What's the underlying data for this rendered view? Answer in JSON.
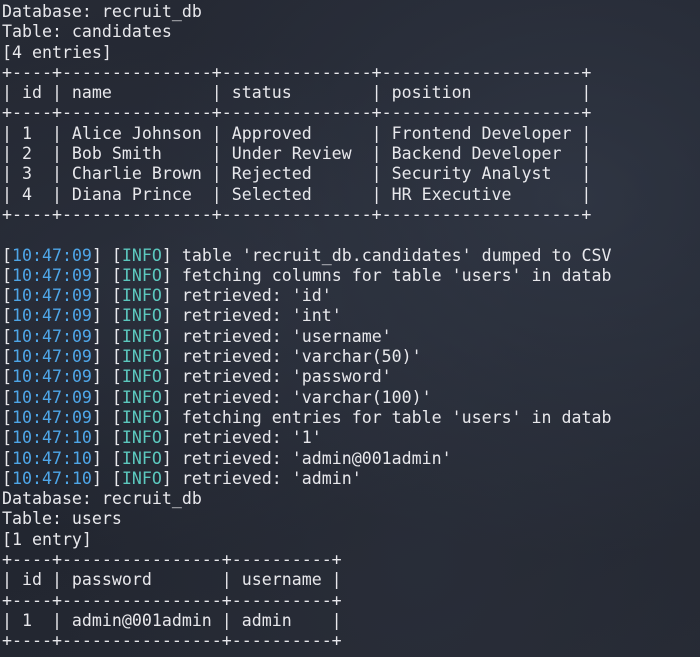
{
  "colors": {
    "background": "#232733",
    "text": "#e8e8ec",
    "timestamp": "#4ea6e8",
    "info_level": "#5cc8be"
  },
  "lines": [
    {
      "text": "Database: recruit_db"
    },
    {
      "text": "Table: candidates"
    },
    {
      "text": "[4 entries]"
    },
    {
      "text": "+----+---------------+---------------+--------------------+"
    },
    {
      "text": "| id | name          | status        | position           |"
    },
    {
      "text": "+----+---------------+---------------+--------------------+"
    },
    {
      "text": "| 1  | Alice Johnson | Approved      | Frontend Developer |"
    },
    {
      "text": "| 2  | Bob Smith     | Under Review  | Backend Developer  |"
    },
    {
      "text": "| 3  | Charlie Brown | Rejected      | Security Analyst   |"
    },
    {
      "text": "| 4  | Diana Prince  | Selected      | HR Executive       |"
    },
    {
      "text": "+----+---------------+---------------+--------------------+"
    },
    {
      "text": ""
    },
    {
      "time": "10:47:09",
      "level": "INFO",
      "msg": "table 'recruit_db.candidates' dumped to CSV"
    },
    {
      "time": "10:47:09",
      "level": "INFO",
      "msg": "fetching columns for table 'users' in datab"
    },
    {
      "time": "10:47:09",
      "level": "INFO",
      "msg": "retrieved: 'id'"
    },
    {
      "time": "10:47:09",
      "level": "INFO",
      "msg": "retrieved: 'int'"
    },
    {
      "time": "10:47:09",
      "level": "INFO",
      "msg": "retrieved: 'username'"
    },
    {
      "time": "10:47:09",
      "level": "INFO",
      "msg": "retrieved: 'varchar(50)'"
    },
    {
      "time": "10:47:09",
      "level": "INFO",
      "msg": "retrieved: 'password'"
    },
    {
      "time": "10:47:09",
      "level": "INFO",
      "msg": "retrieved: 'varchar(100)'"
    },
    {
      "time": "10:47:09",
      "level": "INFO",
      "msg": "fetching entries for table 'users' in datab"
    },
    {
      "time": "10:47:10",
      "level": "INFO",
      "msg": "retrieved: '1'"
    },
    {
      "time": "10:47:10",
      "level": "INFO",
      "msg": "retrieved: 'admin@001admin'"
    },
    {
      "time": "10:47:10",
      "level": "INFO",
      "msg": "retrieved: 'admin'"
    },
    {
      "text": "Database: recruit_db"
    },
    {
      "text": "Table: users"
    },
    {
      "text": "[1 entry]"
    },
    {
      "text": "+----+----------------+----------+"
    },
    {
      "text": "| id | password       | username |"
    },
    {
      "text": "+----+----------------+----------+"
    },
    {
      "text": "| 1  | admin@001admin | admin    |"
    },
    {
      "text": "+----+----------------+----------+"
    }
  ]
}
